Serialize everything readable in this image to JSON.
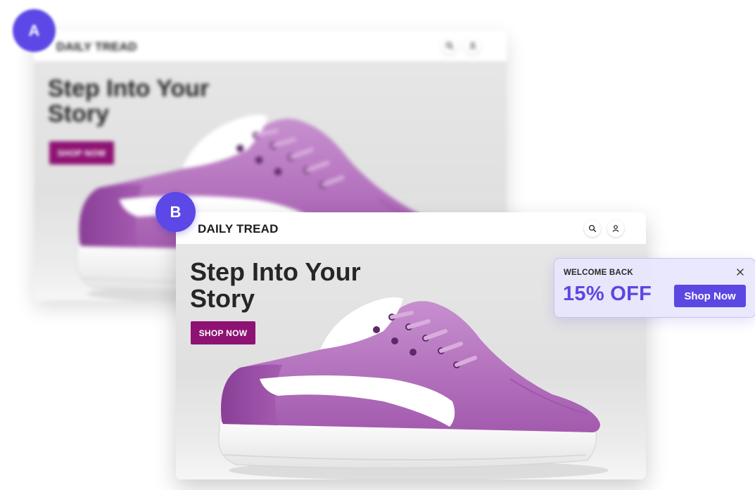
{
  "variant_a": {
    "badge": "A",
    "brand": "DAILY TREAD",
    "headline": "Step Into Your Story",
    "cta": "SHOP NOW",
    "icons": [
      "search-icon",
      "user-icon"
    ]
  },
  "variant_b": {
    "badge": "B",
    "brand": "DAILY TREAD",
    "headline": "Step Into Your Story",
    "cta": "SHOP NOW",
    "icons": [
      "search-icon",
      "user-icon"
    ]
  },
  "popup": {
    "kicker": "WELCOME BACK",
    "offer": "15% OFF",
    "cta": "Shop Now",
    "close_icon": "close-icon"
  },
  "colors": {
    "accent": "#5c48e6",
    "cta_magenta": "#8e1273",
    "shoe_purple": "#a45fb0",
    "popup_bg": "#e8e6fc"
  }
}
